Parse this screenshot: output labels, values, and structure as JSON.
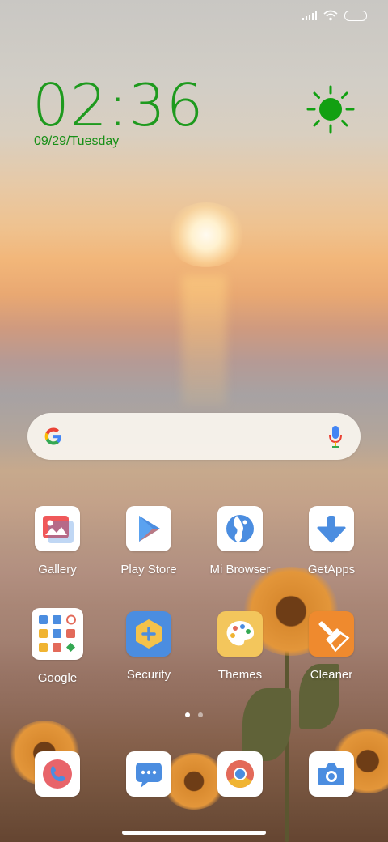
{
  "status_bar": {
    "icons": [
      "signal-icon",
      "wifi-icon",
      "battery-icon"
    ]
  },
  "clock": {
    "time": "02:36",
    "date": "09/29/Tuesday",
    "color": "#1e9a1e"
  },
  "weather": {
    "icon": "sun-icon",
    "color": "#12a012"
  },
  "search": {
    "logo": "google-g-icon",
    "voice": "mic-icon"
  },
  "apps": [
    {
      "label": "Gallery",
      "icon": "gallery-icon"
    },
    {
      "label": "Play Store",
      "icon": "play-store-icon"
    },
    {
      "label": "Mi Browser",
      "icon": "mi-browser-icon"
    },
    {
      "label": "GetApps",
      "icon": "getapps-icon"
    },
    {
      "label": "Google",
      "icon": "google-folder-icon"
    },
    {
      "label": "Security",
      "icon": "security-icon"
    },
    {
      "label": "Themes",
      "icon": "themes-icon"
    },
    {
      "label": "Cleaner",
      "icon": "cleaner-icon"
    }
  ],
  "dock": [
    {
      "icon": "phone-icon"
    },
    {
      "icon": "messages-icon"
    },
    {
      "icon": "chrome-icon"
    },
    {
      "icon": "camera-icon"
    }
  ],
  "page_indicator": {
    "pages": 2,
    "current": 1
  }
}
